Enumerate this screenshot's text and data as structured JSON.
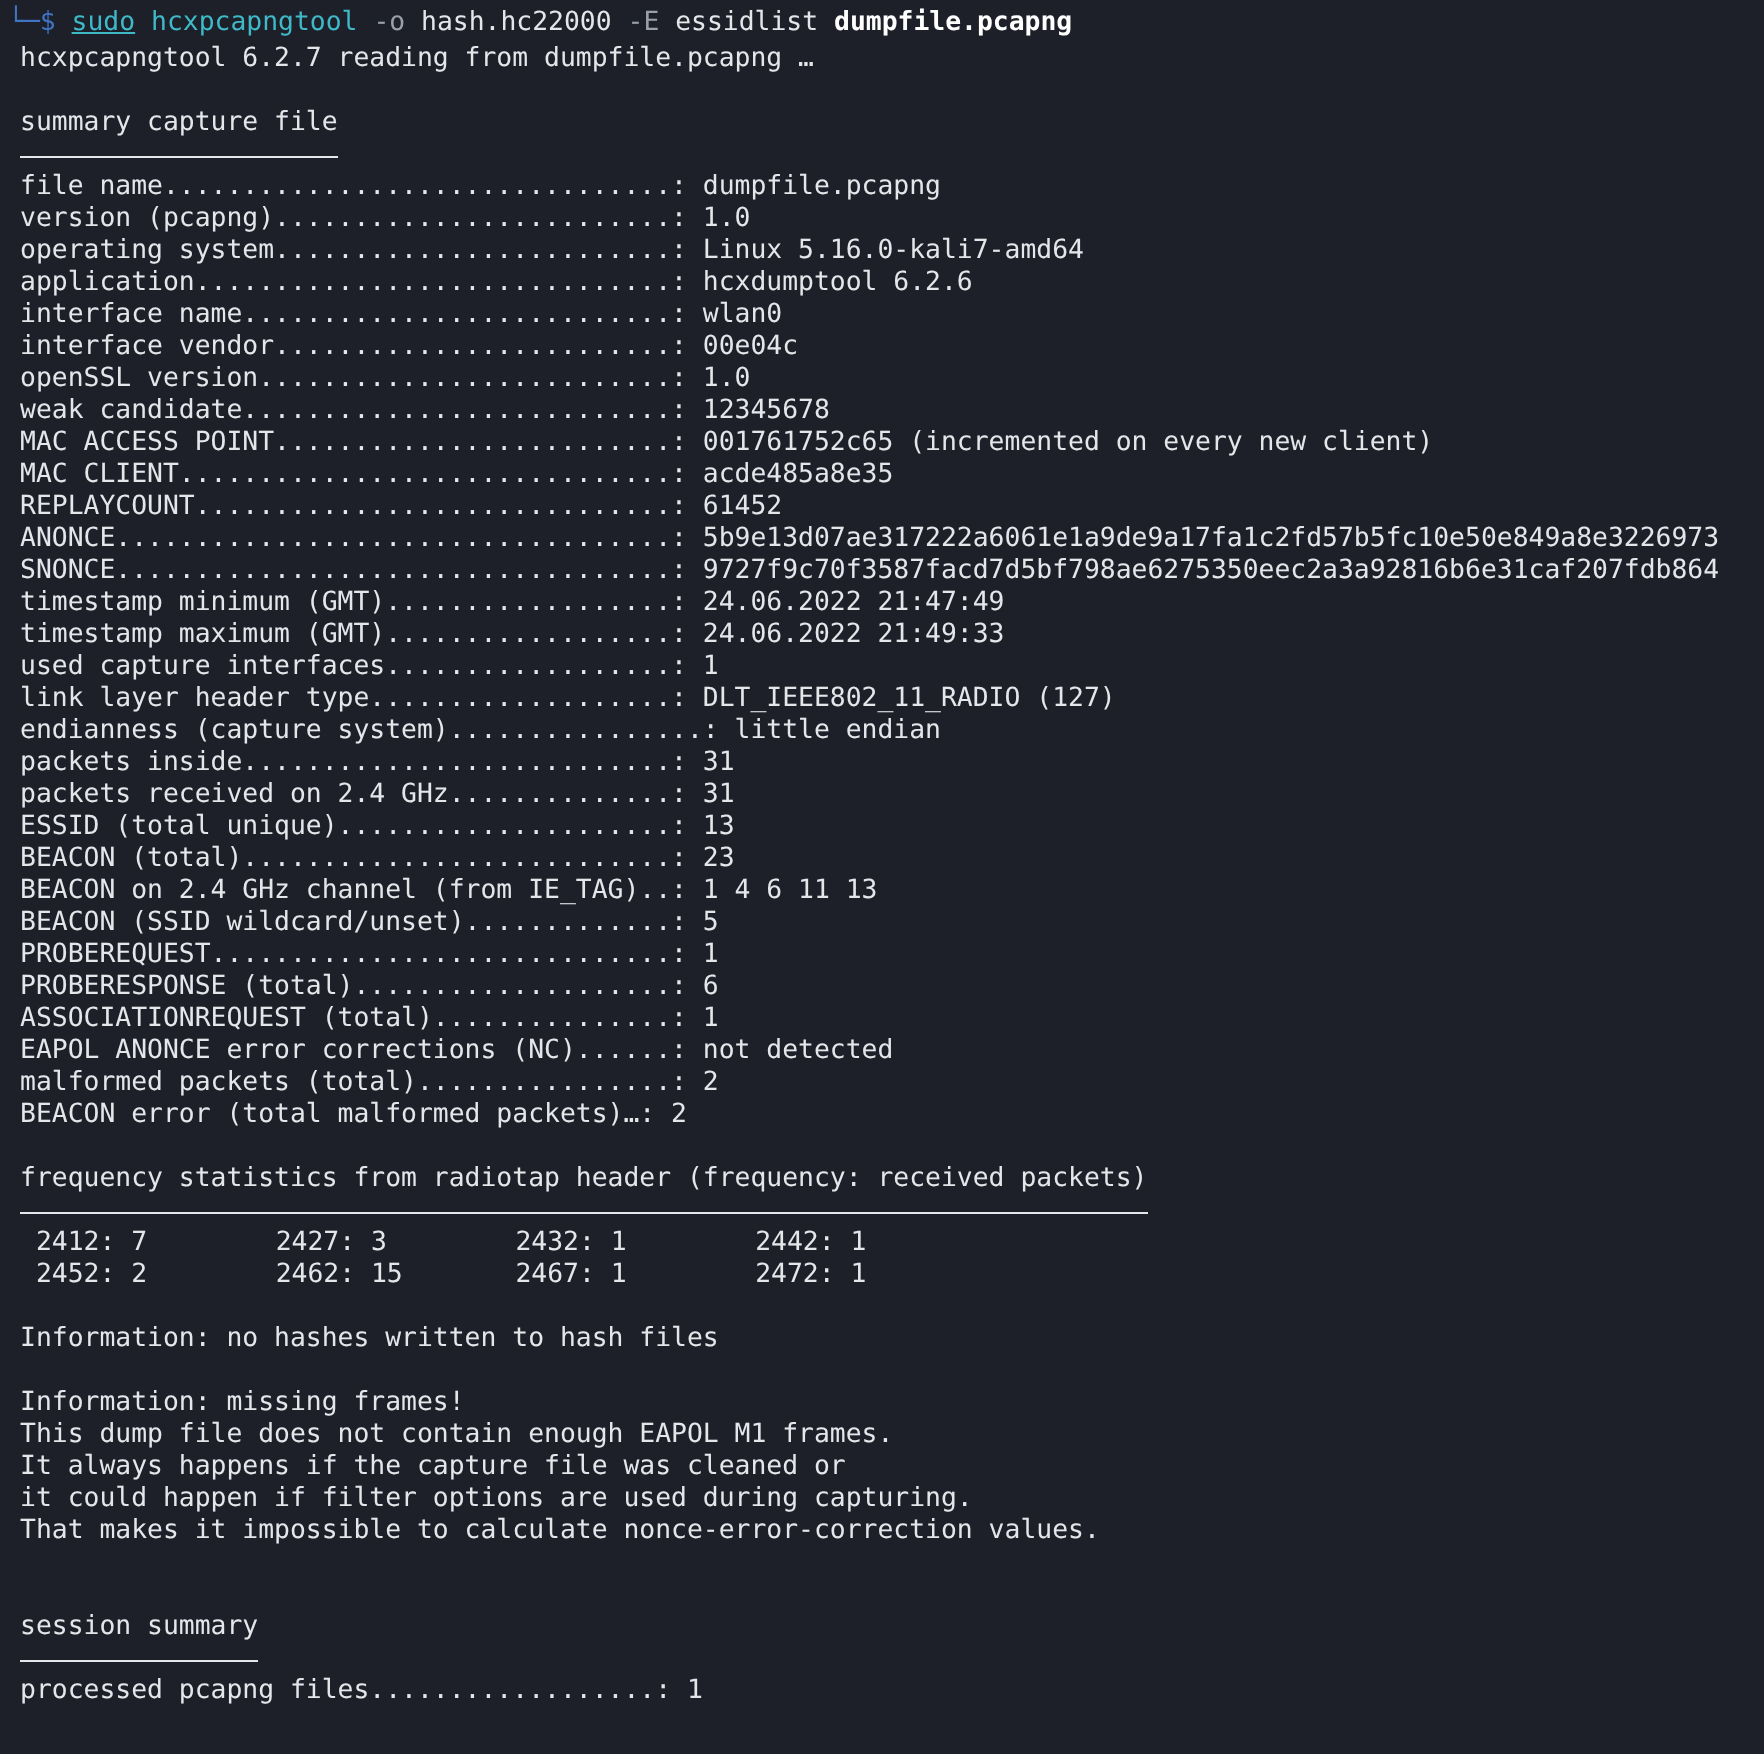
{
  "prompt": {
    "corner": "└─",
    "symbol": "$",
    "sudo": "sudo",
    "command": "hcxpcapngtool",
    "flag_o": "-o",
    "arg_o": "hash.hc22000",
    "flag_e": "-E",
    "arg_e": "essidlist",
    "file": "dumpfile.pcapng"
  },
  "lines": [
    {
      "kind": "text",
      "text": "hcxpcapngtool 6.2.7 reading from dumpfile.pcapng …"
    },
    {
      "kind": "blank"
    },
    {
      "kind": "heading",
      "text": "summary capture file"
    },
    {
      "kind": "text",
      "text": "file name................................: dumpfile.pcapng"
    },
    {
      "kind": "text",
      "text": "version (pcapng).........................: 1.0"
    },
    {
      "kind": "text",
      "text": "operating system.........................: Linux 5.16.0-kali7-amd64"
    },
    {
      "kind": "text",
      "text": "application..............................: hcxdumptool 6.2.6"
    },
    {
      "kind": "text",
      "text": "interface name...........................: wlan0"
    },
    {
      "kind": "text",
      "text": "interface vendor.........................: 00e04c"
    },
    {
      "kind": "text",
      "text": "openSSL version..........................: 1.0"
    },
    {
      "kind": "text",
      "text": "weak candidate...........................: 12345678"
    },
    {
      "kind": "text",
      "text": "MAC ACCESS POINT.........................: 001761752c65 (incremented on every new client)"
    },
    {
      "kind": "text",
      "text": "MAC CLIENT...............................: acde485a8e35"
    },
    {
      "kind": "text",
      "text": "REPLAYCOUNT..............................: 61452"
    },
    {
      "kind": "text",
      "text": "ANONCE...................................: 5b9e13d07ae317222a6061e1a9de9a17fa1c2fd57b5fc10e50e849a8e3226973"
    },
    {
      "kind": "text",
      "text": "SNONCE...................................: 9727f9c70f3587facd7d5bf798ae6275350eec2a3a92816b6e31caf207fdb864"
    },
    {
      "kind": "text",
      "text": "timestamp minimum (GMT)..................: 24.06.2022 21:47:49"
    },
    {
      "kind": "text",
      "text": "timestamp maximum (GMT)..................: 24.06.2022 21:49:33"
    },
    {
      "kind": "text",
      "text": "used capture interfaces..................: 1"
    },
    {
      "kind": "text",
      "text": "link layer header type...................: DLT_IEEE802_11_RADIO (127)"
    },
    {
      "kind": "text",
      "text": "endianness (capture system)................: little endian"
    },
    {
      "kind": "text",
      "text": "packets inside...........................: 31"
    },
    {
      "kind": "text",
      "text": "packets received on 2.4 GHz..............: 31"
    },
    {
      "kind": "text",
      "text": "ESSID (total unique).....................: 13"
    },
    {
      "kind": "text",
      "text": "BEACON (total)...........................: 23"
    },
    {
      "kind": "text",
      "text": "BEACON on 2.4 GHz channel (from IE_TAG)..: 1 4 6 11 13"
    },
    {
      "kind": "text",
      "text": "BEACON (SSID wildcard/unset).............: 5"
    },
    {
      "kind": "text",
      "text": "PROBEREQUEST.............................: 1"
    },
    {
      "kind": "text",
      "text": "PROBERESPONSE (total)....................: 6"
    },
    {
      "kind": "text",
      "text": "ASSOCIATIONREQUEST (total)...............: 1"
    },
    {
      "kind": "text",
      "text": "EAPOL ANONCE error corrections (NC)......: not detected"
    },
    {
      "kind": "text",
      "text": "malformed packets (total)................: 2"
    },
    {
      "kind": "text",
      "text": "BEACON error (total malformed packets)…: 2"
    },
    {
      "kind": "blank"
    },
    {
      "kind": "heading",
      "text": "frequency statistics from radiotap header (frequency: received packets)"
    },
    {
      "kind": "table",
      "cells": [
        "2412: 7",
        "2427: 3",
        "2432: 1",
        "2442: 1",
        "2452: 2",
        "2462: 15",
        "2467: 1",
        "2472: 1"
      ]
    },
    {
      "kind": "blank"
    },
    {
      "kind": "text",
      "text": "Information: no hashes written to hash files"
    },
    {
      "kind": "blank"
    },
    {
      "kind": "text",
      "text": "Information: missing frames!"
    },
    {
      "kind": "text",
      "text": "This dump file does not contain enough EAPOL M1 frames."
    },
    {
      "kind": "text",
      "text": "It always happens if the capture file was cleaned or"
    },
    {
      "kind": "text",
      "text": "it could happen if filter options are used during capturing."
    },
    {
      "kind": "text",
      "text": "That makes it impossible to calculate nonce-error-correction values."
    },
    {
      "kind": "blank"
    },
    {
      "kind": "blank"
    },
    {
      "kind": "heading",
      "text": "session summary"
    },
    {
      "kind": "text",
      "text": "processed pcapng files..................: 1"
    }
  ]
}
